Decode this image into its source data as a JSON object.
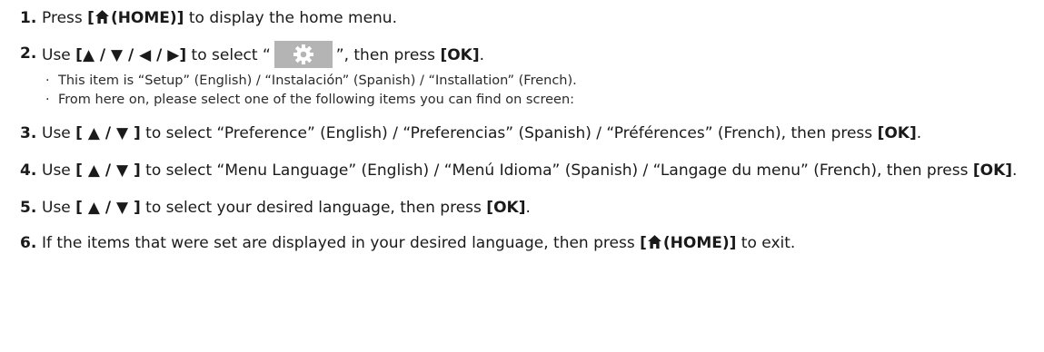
{
  "steps": [
    {
      "num": "1.",
      "parts": [
        "Press ",
        "[",
        "(HOME)]",
        " to display the home menu."
      ]
    },
    {
      "num": "2.",
      "parts": [
        "Use ",
        "[▲ / ▼ / ◀ / ▶]",
        " to select “",
        "”, then press ",
        "[OK]",
        "."
      ],
      "bullets": [
        "This item is “Setup” (English) / “Instalación” (Spanish) / “Installation” (French).",
        "From here on, please select one of the following items you can find on screen:"
      ]
    },
    {
      "num": "3.",
      "parts": [
        "Use ",
        "[ ▲ / ▼ ]",
        " to select “Preference” (English) / “Preferencias” (Spanish) / “Préférences” (French), then press ",
        "[OK]",
        "."
      ]
    },
    {
      "num": "4.",
      "parts": [
        "Use ",
        "[ ▲ / ▼ ]",
        " to select “Menu Language” (English) / “Menú Idioma” (Spanish) / “Langage du menu” (French), then press ",
        "[OK]",
        "."
      ]
    },
    {
      "num": "5.",
      "parts": [
        "Use ",
        "[ ▲ / ▼ ]",
        " to select your desired language, then press ",
        "[OK]",
        "."
      ]
    },
    {
      "num": "6.",
      "parts": [
        "If the items that were set are displayed in your desired language, then press ",
        "[",
        "(HOME)]",
        " to exit."
      ]
    }
  ],
  "icons": {
    "home": "home-icon",
    "setup": "gear-icon"
  },
  "colors": {
    "text": "#1a1a1a",
    "icon_box": "#b4b4b4",
    "icon_fg": "#ffffff"
  }
}
